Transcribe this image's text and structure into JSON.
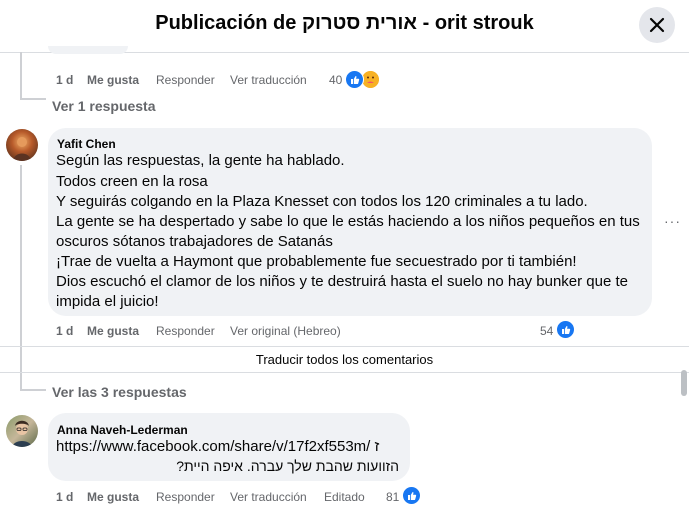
{
  "dialog": {
    "title": "Publicación de אורית סטרוק - orit strouk",
    "close_icon": "close-icon"
  },
  "prev_comment": {
    "time": "1 d",
    "like": "Me gusta",
    "reply": "Responder",
    "translate": "Ver traducción",
    "reaction_count": "40",
    "reactions": [
      "like-icon",
      "care-icon"
    ]
  },
  "replies_link_1": "Ver 1 respuesta",
  "comment_yafit": {
    "author": "Yafit Chen",
    "lines": [
      "Según las respuestas, la gente ha hablado.",
      "Todos creen en la rosa",
      "Y seguirás colgando en la Plaza Knesset con todos los 120 criminales a tu lado.",
      "La gente se ha despertado y sabe lo que le estás haciendo a los niños pequeños en tus",
      "oscuros sótanos trabajadores de Satanás",
      "¡Trae de vuelta a Haymont que probablemente fue secuestrado por ti también!",
      "Dios escuchó el clamor de los niños y te destruirá hasta el suelo no hay bunker que te",
      "impida el juicio!"
    ],
    "time": "1 d",
    "like": "Me gusta",
    "reply": "Responder",
    "original": "Ver original (Hebreo)",
    "reaction_count": "54",
    "more": "···"
  },
  "translate_all": "Traducir todos los comentarios",
  "replies_link_3": "Ver las 3 respuestas",
  "comment_anna": {
    "author": "Anna Naveh-Lederman",
    "line1": "https://www.facebook.com/share/v/17f2xf553m/ ז",
    "line2": "הזוועות שהבת שלך עברה. איפה היית?",
    "time": "1 d",
    "like": "Me gusta",
    "reply": "Responder",
    "translate": "Ver traducción",
    "edited": "Editado",
    "reaction_count": "81"
  },
  "colors": {
    "bubble": "#f0f2f5",
    "meta": "#65676b",
    "like_blue": "#1877f2",
    "divider": "#dadde1"
  }
}
